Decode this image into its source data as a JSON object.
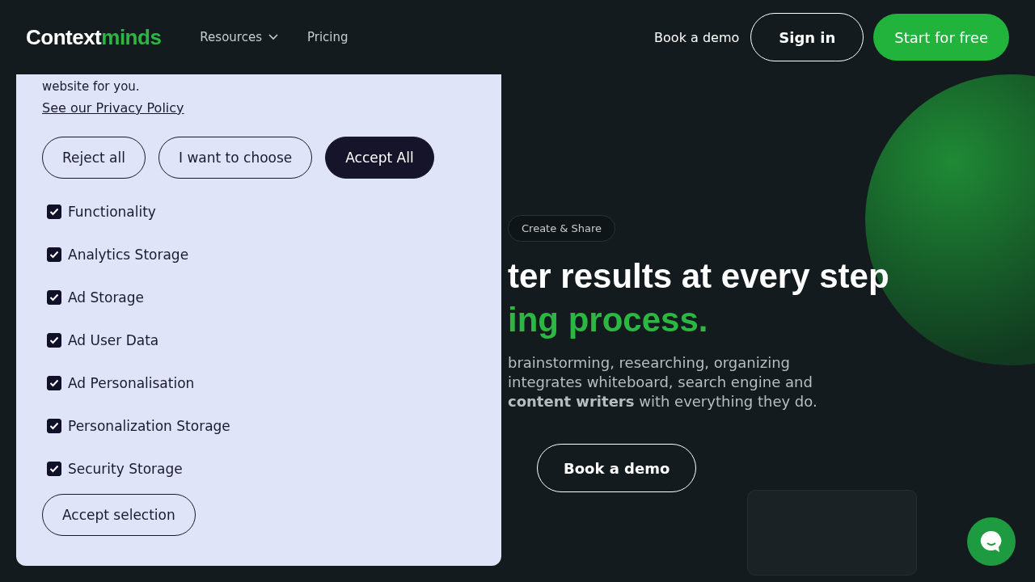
{
  "header": {
    "logo_part_1": "Context",
    "logo_part_2": "minds",
    "nav": [
      {
        "label": "Resources",
        "dropdown": true
      },
      {
        "label": "Pricing",
        "dropdown": false
      }
    ],
    "demo_link": "Book a demo",
    "sign_in": "Sign in",
    "cta": "Start for free"
  },
  "consent": {
    "intro": "website for you.",
    "policy_link": "See our Privacy Policy",
    "buttons": [
      {
        "label": "Reject all",
        "kind": "outline"
      },
      {
        "label": "I want to choose",
        "kind": "outline"
      },
      {
        "label": "Accept All",
        "kind": "filled"
      }
    ],
    "options": [
      {
        "label": "Functionality",
        "checked": true
      },
      {
        "label": "Analytics Storage",
        "checked": true
      },
      {
        "label": "Ad Storage",
        "checked": true
      },
      {
        "label": "Ad User Data",
        "checked": true
      },
      {
        "label": "Ad Personalisation",
        "checked": true
      },
      {
        "label": "Personalization Storage",
        "checked": true
      },
      {
        "label": "Security Storage",
        "checked": true
      }
    ],
    "save": "Accept selection"
  },
  "hero": {
    "tag": "Create & Share",
    "title_line_1": "ter results at every step",
    "title_line_2": "ing process.",
    "description": [
      "brainstorming, researching, organizing",
      "integrates whiteboard, search engine and",
      "**content writers** with everything they do."
    ],
    "button": "Book a demo"
  }
}
